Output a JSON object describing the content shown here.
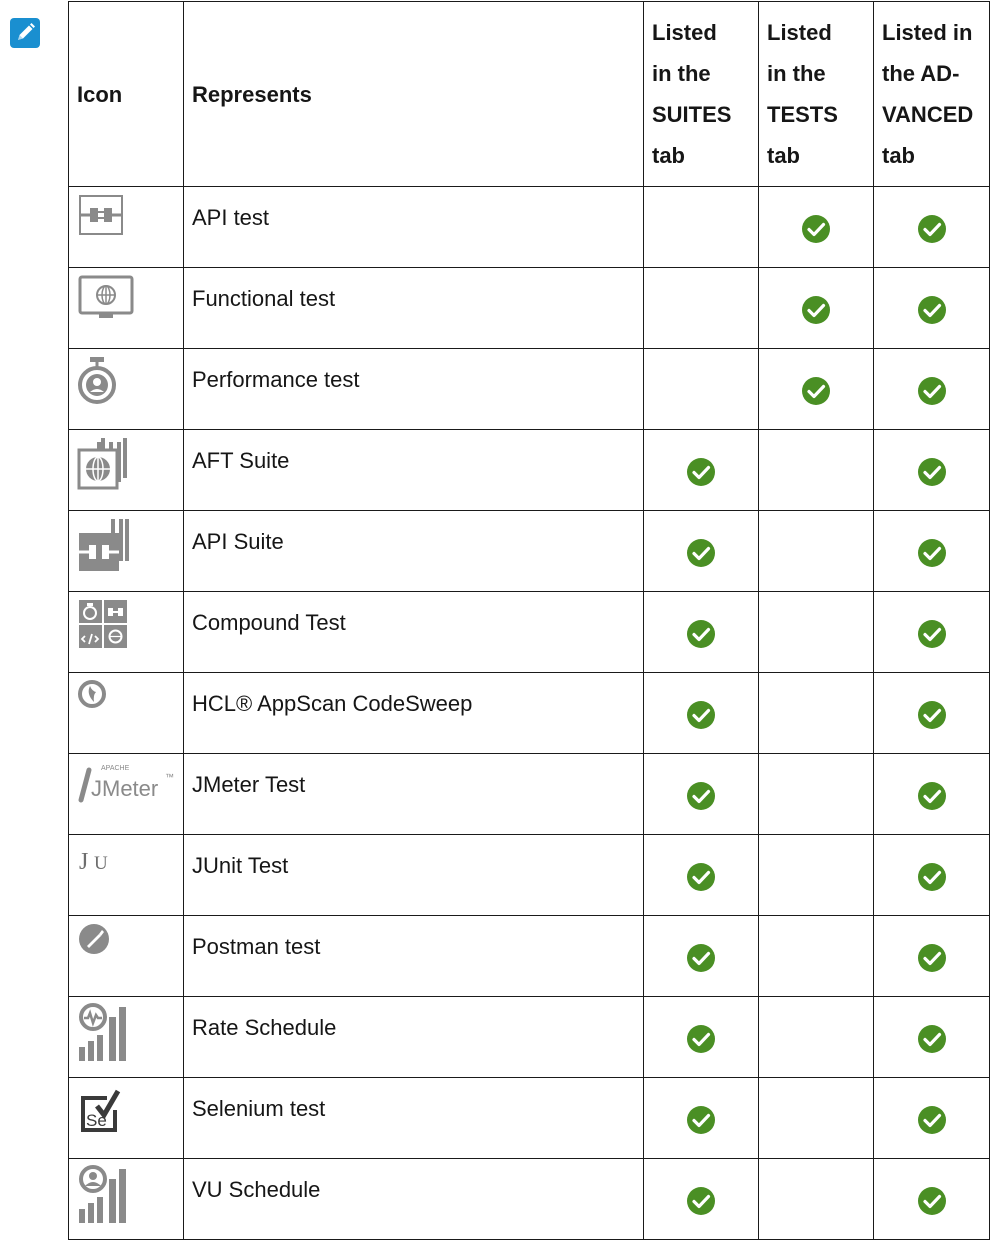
{
  "colors": {
    "check_green": "#4a8f24",
    "note_blue": "#1a8fd0",
    "icon_gray": "#8a8a8a"
  },
  "note_icon": "pencil-note-icon",
  "table": {
    "headers": {
      "icon": "Icon",
      "represents": "Represents",
      "suites": [
        "Listed",
        "in the",
        "SUITES",
        "tab"
      ],
      "tests": [
        "Listed",
        "in the",
        "TESTS",
        "tab"
      ],
      "advanced": [
        "Listed in",
        "the AD-",
        "VANCED",
        "tab"
      ]
    },
    "rows": [
      {
        "icon": "api-test-icon",
        "label": "API test",
        "suites": false,
        "tests": true,
        "advanced": true
      },
      {
        "icon": "functional-test-icon",
        "label": "Functional test",
        "suites": false,
        "tests": true,
        "advanced": true
      },
      {
        "icon": "performance-test-icon",
        "label": "Performance test",
        "suites": false,
        "tests": true,
        "advanced": true
      },
      {
        "icon": "aft-suite-icon",
        "label": "AFT Suite",
        "suites": true,
        "tests": false,
        "advanced": true
      },
      {
        "icon": "api-suite-icon",
        "label": "API Suite",
        "suites": true,
        "tests": false,
        "advanced": true
      },
      {
        "icon": "compound-test-icon",
        "label": "Compound Test",
        "suites": true,
        "tests": false,
        "advanced": true
      },
      {
        "icon": "codesweep-icon",
        "label": "HCL® AppScan CodeSweep",
        "suites": true,
        "tests": false,
        "advanced": true
      },
      {
        "icon": "jmeter-icon",
        "label": "JMeter Test",
        "suites": true,
        "tests": false,
        "advanced": true,
        "icon_text": "JMeter",
        "icon_small_text": "APACHE",
        "icon_tm": "™"
      },
      {
        "icon": "junit-icon",
        "label": "JUnit Test",
        "suites": true,
        "tests": false,
        "advanced": true,
        "icon_text": "JU"
      },
      {
        "icon": "postman-icon",
        "label": "Postman test",
        "suites": true,
        "tests": false,
        "advanced": true
      },
      {
        "icon": "rate-schedule-icon",
        "label": "Rate Schedule",
        "suites": true,
        "tests": false,
        "advanced": true
      },
      {
        "icon": "selenium-icon",
        "label": "Selenium test",
        "suites": true,
        "tests": false,
        "advanced": true,
        "icon_text": "Se"
      },
      {
        "icon": "vu-schedule-icon",
        "label": "VU Schedule",
        "suites": true,
        "tests": false,
        "advanced": true
      }
    ]
  }
}
